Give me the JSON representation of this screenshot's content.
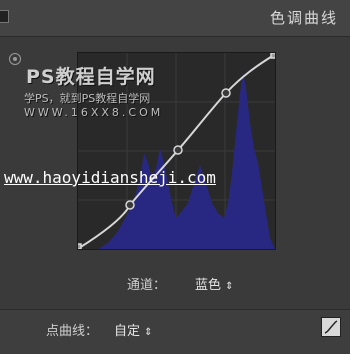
{
  "panel": {
    "title": "色调曲线"
  },
  "watermark": {
    "brand": "PS教程自学网",
    "tagline": "学PS，就到PS教程自学网",
    "site_short": "WWW.16XX8.COM",
    "site_url": "www.haoyidiansheji.com"
  },
  "channel": {
    "label": "通道：",
    "value": "蓝色",
    "arrows": "⇕"
  },
  "point_curve": {
    "label": "点曲线：",
    "value": "自定",
    "arrows": "⇕"
  },
  "curve": {
    "points": [
      [
        0,
        0
      ],
      [
        0.25,
        0.22
      ],
      [
        0.5,
        0.5
      ],
      [
        0.75,
        0.79
      ],
      [
        1,
        1
      ]
    ],
    "histogram_color": "#28288c",
    "line_color": "#d7d7d7"
  },
  "icons": [
    "target-adjust-icon",
    "collapse-icon",
    "edit-curve-icon",
    "chevron-updown-icon"
  ]
}
